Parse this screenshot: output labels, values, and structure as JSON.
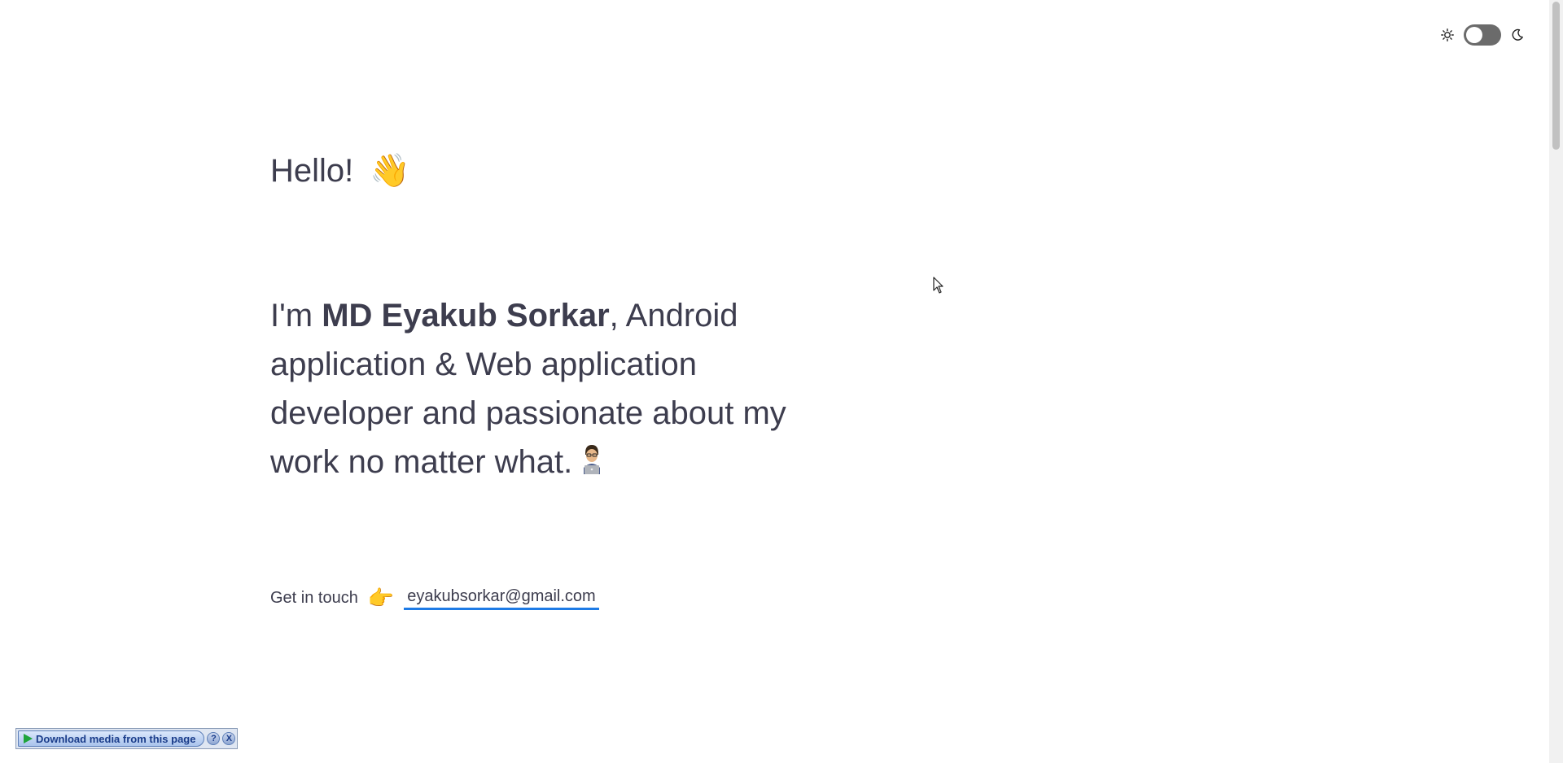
{
  "theme_toggle": {
    "light_icon": "sun-icon",
    "dark_icon": "moon-icon",
    "state": "light"
  },
  "hero": {
    "greeting": "Hello!",
    "greeting_emoji": "👋",
    "intro_prefix": "I'm ",
    "name": "MD Eyakub Sorkar",
    "intro_suffix": ", Android application & Web application developer and passionate about my work no matter what.",
    "intro_emoji_icon": "developer-emoji-icon"
  },
  "contact": {
    "label": "Get in touch",
    "pointer_emoji": "👉",
    "email": "eyakubsorkar@gmail.com"
  },
  "media_bar": {
    "download_label": "Download media from this page",
    "help_label": "?",
    "close_label": "X"
  },
  "colors": {
    "text": "#3d3d4e",
    "link_underline": "#1e7be6",
    "toggle_track": "#6b6b6b",
    "background": "#ffffff"
  }
}
